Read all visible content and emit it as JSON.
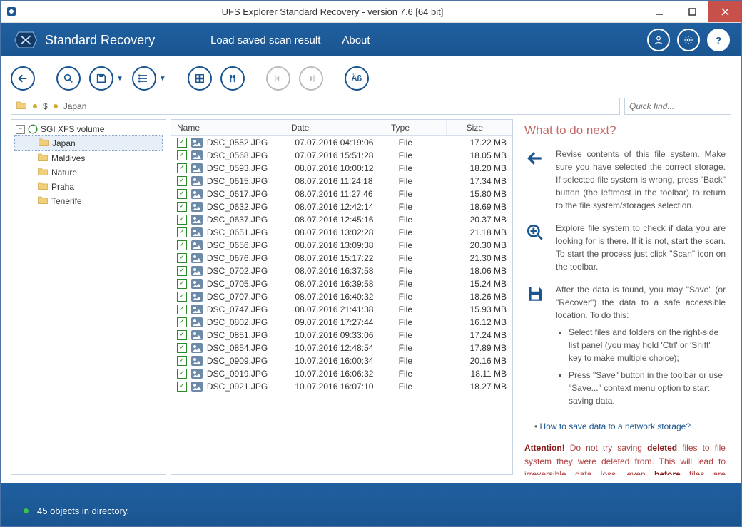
{
  "title": "UFS Explorer Standard Recovery - version 7.6 [64 bit]",
  "brand": "Standard Recovery",
  "menu": {
    "load": "Load saved scan result",
    "about": "About"
  },
  "breadcrumb": {
    "root_symbol": "$",
    "current": "Japan"
  },
  "quickfind_placeholder": "Quick find...",
  "tree": {
    "root": "SGI XFS volume",
    "folders": [
      "Japan",
      "Maldives",
      "Nature",
      "Praha",
      "Tenerife"
    ],
    "selected": "Japan"
  },
  "columns": {
    "name": "Name",
    "date": "Date",
    "type": "Type",
    "size": "Size"
  },
  "files": [
    {
      "name": "DSC_0552.JPG",
      "date": "07.07.2016 04:19:06",
      "type": "File",
      "size": "17.22 MB"
    },
    {
      "name": "DSC_0568.JPG",
      "date": "07.07.2016 15:51:28",
      "type": "File",
      "size": "18.05 MB"
    },
    {
      "name": "DSC_0593.JPG",
      "date": "08.07.2016 10:00:12",
      "type": "File",
      "size": "18.20 MB"
    },
    {
      "name": "DSC_0615.JPG",
      "date": "08.07.2016 11:24:18",
      "type": "File",
      "size": "17.34 MB"
    },
    {
      "name": "DSC_0617.JPG",
      "date": "08.07.2016 11:27:46",
      "type": "File",
      "size": "15.80 MB"
    },
    {
      "name": "DSC_0632.JPG",
      "date": "08.07.2016 12:42:14",
      "type": "File",
      "size": "18.69 MB"
    },
    {
      "name": "DSC_0637.JPG",
      "date": "08.07.2016 12:45:16",
      "type": "File",
      "size": "20.37 MB"
    },
    {
      "name": "DSC_0651.JPG",
      "date": "08.07.2016 13:02:28",
      "type": "File",
      "size": "21.18 MB"
    },
    {
      "name": "DSC_0656.JPG",
      "date": "08.07.2016 13:09:38",
      "type": "File",
      "size": "20.30 MB"
    },
    {
      "name": "DSC_0676.JPG",
      "date": "08.07.2016 15:17:22",
      "type": "File",
      "size": "21.30 MB"
    },
    {
      "name": "DSC_0702.JPG",
      "date": "08.07.2016 16:37:58",
      "type": "File",
      "size": "18.06 MB"
    },
    {
      "name": "DSC_0705.JPG",
      "date": "08.07.2016 16:39:58",
      "type": "File",
      "size": "15.24 MB"
    },
    {
      "name": "DSC_0707.JPG",
      "date": "08.07.2016 16:40:32",
      "type": "File",
      "size": "18.26 MB"
    },
    {
      "name": "DSC_0747.JPG",
      "date": "08.07.2016 21:41:38",
      "type": "File",
      "size": "15.93 MB"
    },
    {
      "name": "DSC_0802.JPG",
      "date": "09.07.2016 17:27:44",
      "type": "File",
      "size": "16.12 MB"
    },
    {
      "name": "DSC_0851.JPG",
      "date": "10.07.2016 09:33:06",
      "type": "File",
      "size": "17.24 MB"
    },
    {
      "name": "DSC_0854.JPG",
      "date": "10.07.2016 12:48:54",
      "type": "File",
      "size": "17.89 MB"
    },
    {
      "name": "DSC_0909.JPG",
      "date": "10.07.2016 16:00:34",
      "type": "File",
      "size": "20.16 MB"
    },
    {
      "name": "DSC_0919.JPG",
      "date": "10.07.2016 16:06:32",
      "type": "File",
      "size": "18.11 MB"
    },
    {
      "name": "DSC_0921.JPG",
      "date": "10.07.2016 16:07:10",
      "type": "File",
      "size": "18.27 MB"
    }
  ],
  "help": {
    "heading": "What to do next?",
    "p1": "Revise contents of this file system. Make sure you have selected the correct storage. If selected file system is wrong, press \"Back\" button (the leftmost in the toolbar) to return to the file system/storages selection.",
    "p2": "Explore file system to check if data you are looking for is there. If it is not, start the scan. To start the process just click \"Scan\" icon on the toolbar.",
    "p3_lead": "After the data is found, you may \"Save\" (or \"Recover\") the data to a safe accessible location. To do this:",
    "p3_li1": "Select files and folders on the right-side list panel (you may hold 'Ctrl' or 'Shift' key to make multiple choice);",
    "p3_li2": "Press \"Save\" button in the toolbar or use \"Save...\" context menu option to start saving data.",
    "link": "How to save data to a network storage?",
    "attn_label": "Attention!",
    "attn_1": " Do not try saving ",
    "attn_deleted": "deleted",
    "attn_2": " files to file system they were deleted from. This will lead to ",
    "attn_irrev": "irreversible",
    "attn_3": " data loss, even ",
    "attn_before": "before",
    "attn_4": " files are recovered!"
  },
  "status": "45 objects in directory."
}
